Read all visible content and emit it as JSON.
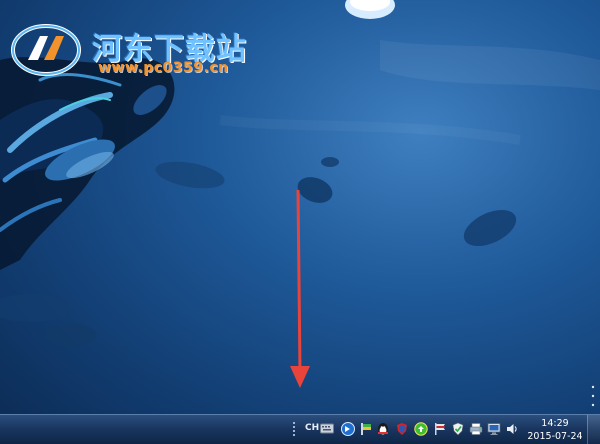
{
  "watermark": {
    "title": "河东下载站",
    "url": "www.pc0359.cn"
  },
  "taskbar": {
    "language": "CH",
    "clock": {
      "time": "14:29",
      "date": "2015-07-24"
    },
    "tray_icons": [
      "keyboard-icon",
      "browser-icon",
      "network-flag-icon",
      "qq-penguin-icon",
      "security-shield-icon",
      "green-sync-icon",
      "flag-icon",
      "shield-check-icon",
      "printer-icon",
      "monitor-icon",
      "speaker-icon"
    ]
  },
  "colors": {
    "arrow": "#e8443c",
    "watermark_title": "#6fc1ff",
    "watermark_url": "#f2922d",
    "taskbar": "#1a3761"
  }
}
